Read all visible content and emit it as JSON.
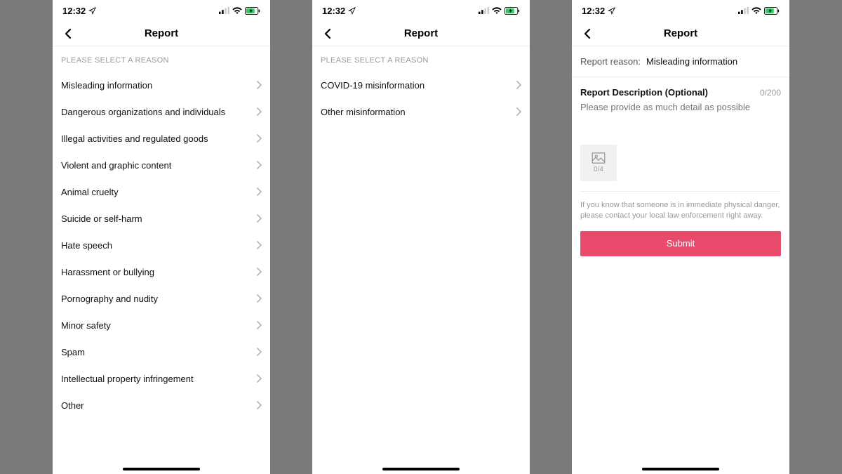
{
  "status": {
    "time": "12:32"
  },
  "nav": {
    "title": "Report"
  },
  "section_header": "PLEASE SELECT A REASON",
  "screen1": {
    "items": [
      {
        "label": "Misleading information"
      },
      {
        "label": "Dangerous organizations and individuals"
      },
      {
        "label": "Illegal activities and regulated goods"
      },
      {
        "label": "Violent and graphic content"
      },
      {
        "label": "Animal cruelty"
      },
      {
        "label": "Suicide or self-harm"
      },
      {
        "label": "Hate speech"
      },
      {
        "label": "Harassment or bullying"
      },
      {
        "label": "Pornography and nudity"
      },
      {
        "label": "Minor safety"
      },
      {
        "label": "Spam"
      },
      {
        "label": "Intellectual property infringement"
      },
      {
        "label": "Other"
      }
    ]
  },
  "screen2": {
    "items": [
      {
        "label": "COVID-19 misinformation"
      },
      {
        "label": "Other misinformation"
      }
    ]
  },
  "screen3": {
    "reason_label": "Report reason:",
    "reason_value": "Misleading information",
    "desc_title": "Report Description (Optional)",
    "char_count": "0/200",
    "desc_placeholder": "Please provide as much detail as possible",
    "upload_count": "0/4",
    "disclaimer": "If you know that someone is in immediate physical danger, please contact your local law enforcement right away.",
    "submit_label": "Submit"
  }
}
